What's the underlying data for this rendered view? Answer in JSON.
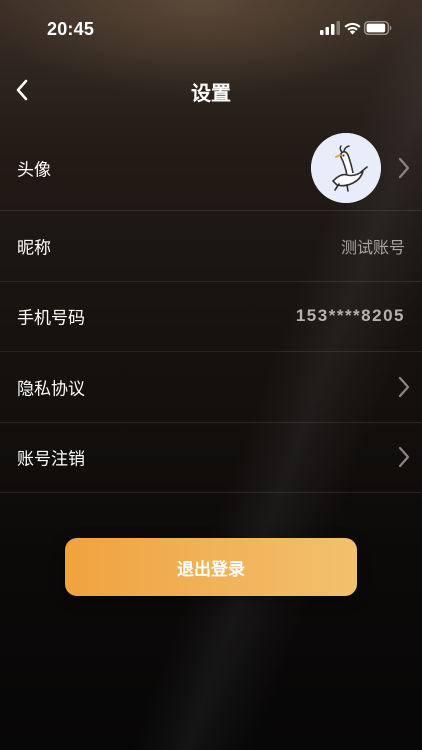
{
  "status_bar": {
    "time": "20:45",
    "icons": [
      "cellular-signal-icon",
      "wifi-icon",
      "battery-icon"
    ]
  },
  "header": {
    "title": "设置",
    "back_icon": "chevron-left-icon"
  },
  "settings": {
    "avatar_label": "头像",
    "avatar_icon": "avatar-image",
    "nickname_label": "昵称",
    "nickname_value": "测试账号",
    "phone_label": "手机号码",
    "phone_value": "153****8205",
    "privacy_label": "隐私协议",
    "cancel_account_label": "账号注销"
  },
  "logout": {
    "label": "退出登录"
  },
  "colors": {
    "button_gradient_start": "#f0a33d",
    "button_gradient_end": "#f3c06d",
    "secondary_text": "#a7a4a2",
    "background_dark": "#0b0908"
  }
}
